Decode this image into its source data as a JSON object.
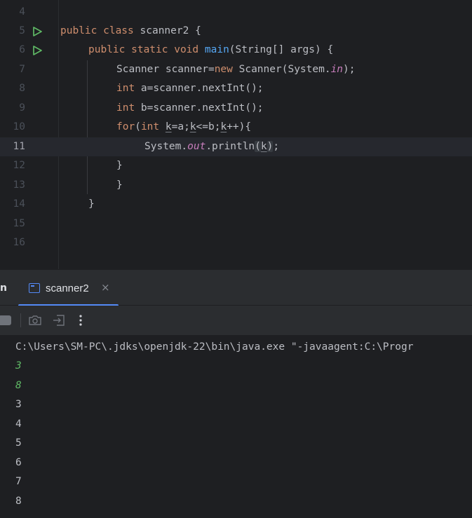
{
  "editor": {
    "line_numbers": [
      "4",
      "5",
      "6",
      "7",
      "8",
      "9",
      "10",
      "11",
      "12",
      "13",
      "14",
      "15",
      "16"
    ],
    "current_line": "11",
    "code": {
      "l5": {
        "kw1": "public class ",
        "name": "scanner2 {"
      },
      "l6": {
        "kw1": "public static void ",
        "fn": "main",
        "rest": "(String[] args) {"
      },
      "l7": {
        "a": "Scanner scanner=",
        "kw": "new",
        "b": " Scanner(System.",
        "fld": "in",
        "c": ");"
      },
      "l8": {
        "kw": "int",
        "rest": " a=scanner.nextInt();"
      },
      "l9": {
        "kw": "int",
        "rest": " b=scanner.nextInt();"
      },
      "l10": {
        "kw1": "for",
        "p1": "(",
        "kw2": "int",
        "sp": " ",
        "v1": "k",
        "p2": "=a;",
        "v2": "k",
        "p3": "<=b;",
        "v3": "k",
        "p4": "++){"
      },
      "l11": {
        "a": "System.",
        "fld": "out",
        "b": ".println",
        "p1": "(",
        "v": "k",
        "p2": ")",
        "c": ";"
      },
      "l12": "}",
      "l13": "}",
      "l14": "}"
    }
  },
  "run_panel": {
    "cut_label": "n",
    "tab": {
      "label": "scanner2",
      "close": "×"
    },
    "icons": {
      "stop": "stop-icon",
      "screenshot": "camera-icon",
      "restore": "restore-layout-icon",
      "more": "more-vertical-icon"
    },
    "console_lines": [
      {
        "text": "C:\\Users\\SM-PC\\.jdks\\openjdk-22\\bin\\java.exe \"-javaagent:C:\\Progr",
        "input": false
      },
      {
        "text": "3",
        "input": true
      },
      {
        "text": "8",
        "input": true
      },
      {
        "text": "3",
        "input": false
      },
      {
        "text": "4",
        "input": false
      },
      {
        "text": "5",
        "input": false
      },
      {
        "text": "6",
        "input": false
      },
      {
        "text": "7",
        "input": false
      },
      {
        "text": "8",
        "input": false
      }
    ]
  },
  "colors": {
    "accent": "#548af7",
    "keyword": "#cf8e6d",
    "function": "#56a8f5",
    "field": "#c77dbb",
    "user_input": "#5fb865",
    "run_marker": "#5fb865"
  }
}
